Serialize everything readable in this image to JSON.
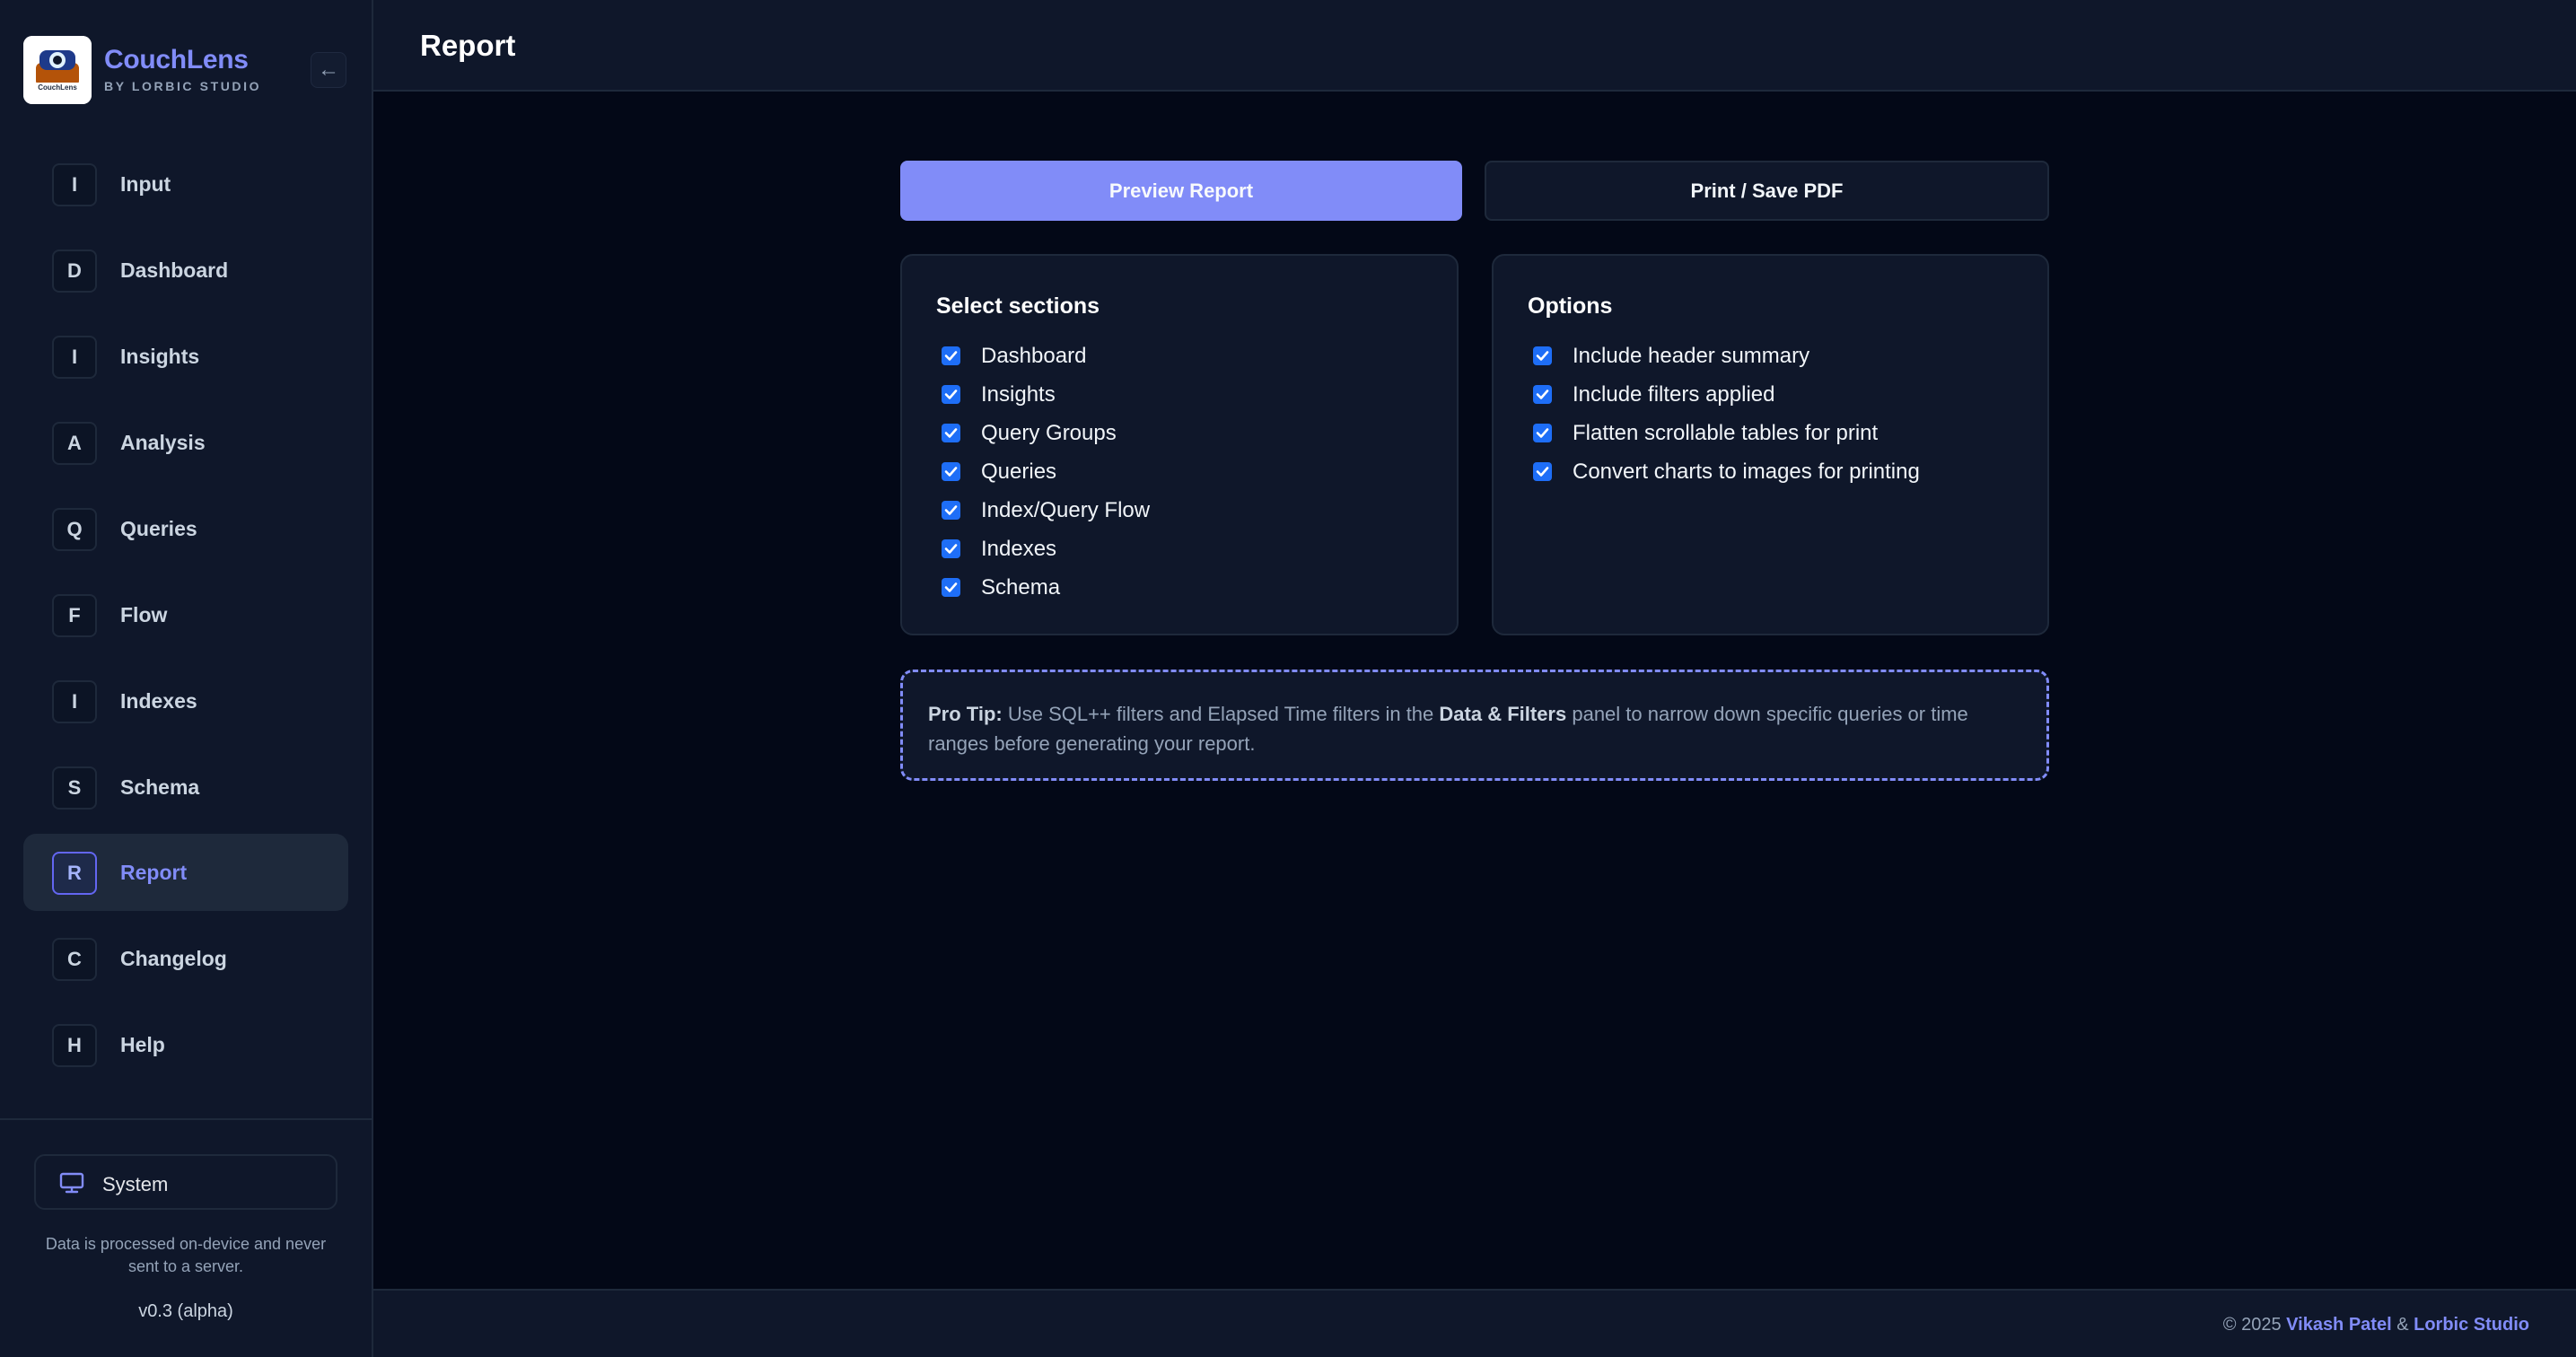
{
  "brand": {
    "name": "CouchLens",
    "subtitle": "BY LORBIC STUDIO",
    "logo_text": "CouchLens",
    "collapse_icon": "←"
  },
  "nav": {
    "items": [
      {
        "badge": "I",
        "label": "Input"
      },
      {
        "badge": "D",
        "label": "Dashboard"
      },
      {
        "badge": "I",
        "label": "Insights"
      },
      {
        "badge": "A",
        "label": "Analysis"
      },
      {
        "badge": "Q",
        "label": "Queries"
      },
      {
        "badge": "F",
        "label": "Flow"
      },
      {
        "badge": "I",
        "label": "Indexes"
      },
      {
        "badge": "S",
        "label": "Schema"
      },
      {
        "badge": "R",
        "label": "Report"
      },
      {
        "badge": "C",
        "label": "Changelog"
      },
      {
        "badge": "H",
        "label": "Help"
      }
    ],
    "active": "Report"
  },
  "sidebar_footer": {
    "theme_label": "System",
    "privacy_note": "Data is processed on-device and never sent to a server.",
    "version": "v0.3 (alpha)"
  },
  "header": {
    "title": "Report"
  },
  "actions": {
    "preview_label": "Preview Report",
    "print_label": "Print / Save PDF"
  },
  "sections_card": {
    "title": "Select sections",
    "items": [
      {
        "label": "Dashboard",
        "checked": true
      },
      {
        "label": "Insights",
        "checked": true
      },
      {
        "label": "Query Groups",
        "checked": true
      },
      {
        "label": "Queries",
        "checked": true
      },
      {
        "label": "Index/Query Flow",
        "checked": true
      },
      {
        "label": "Indexes",
        "checked": true
      },
      {
        "label": "Schema",
        "checked": true
      }
    ]
  },
  "options_card": {
    "title": "Options",
    "items": [
      {
        "label": "Include header summary",
        "checked": true
      },
      {
        "label": "Include filters applied",
        "checked": true
      },
      {
        "label": "Flatten scrollable tables for print",
        "checked": true
      },
      {
        "label": "Convert charts to images for printing",
        "checked": true
      }
    ]
  },
  "tip": {
    "prefix": "Pro Tip:",
    "text_1": " Use SQL++ filters and Elapsed Time filters in the ",
    "highlight": "Data & Filters",
    "text_2": " panel to narrow down specific queries or time ranges before generating your report."
  },
  "footer": {
    "copyright": "© 2025",
    "author": "Vikash Patel",
    "separator": "&",
    "studio": "Lorbic Studio"
  },
  "colors": {
    "accent": "#818cf8",
    "background": "#030817",
    "panel": "#0f172a",
    "checkbox": "#1e6ef7"
  },
  "icons": {
    "theme": "monitor-icon",
    "collapse": "arrow-left-icon",
    "check": "checkmark-icon"
  }
}
